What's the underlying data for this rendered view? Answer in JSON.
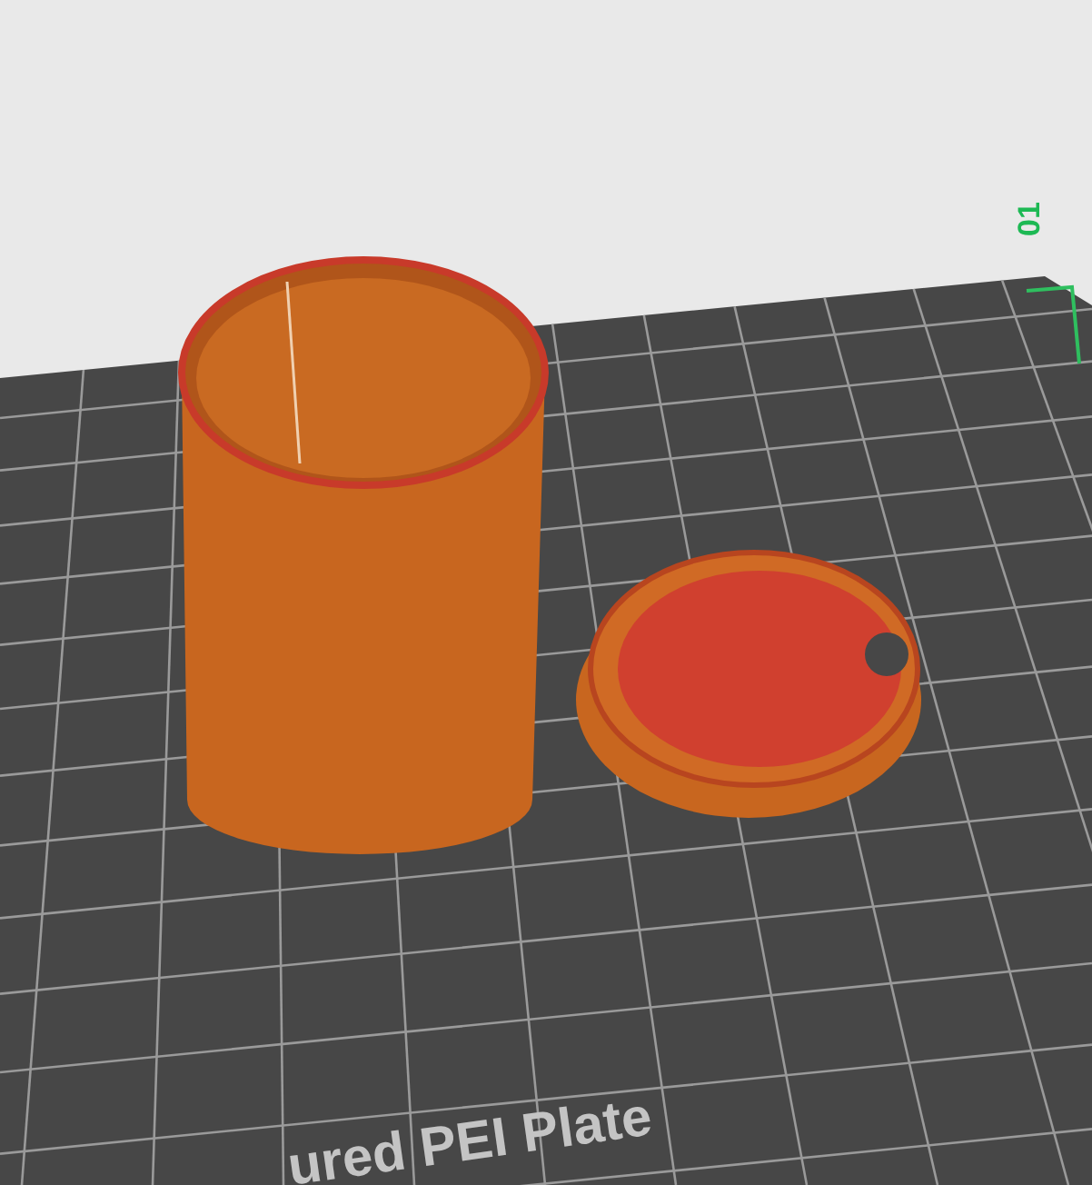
{
  "viewport": {
    "plate_number": "01",
    "plate_label": "ured PEI Plate"
  }
}
